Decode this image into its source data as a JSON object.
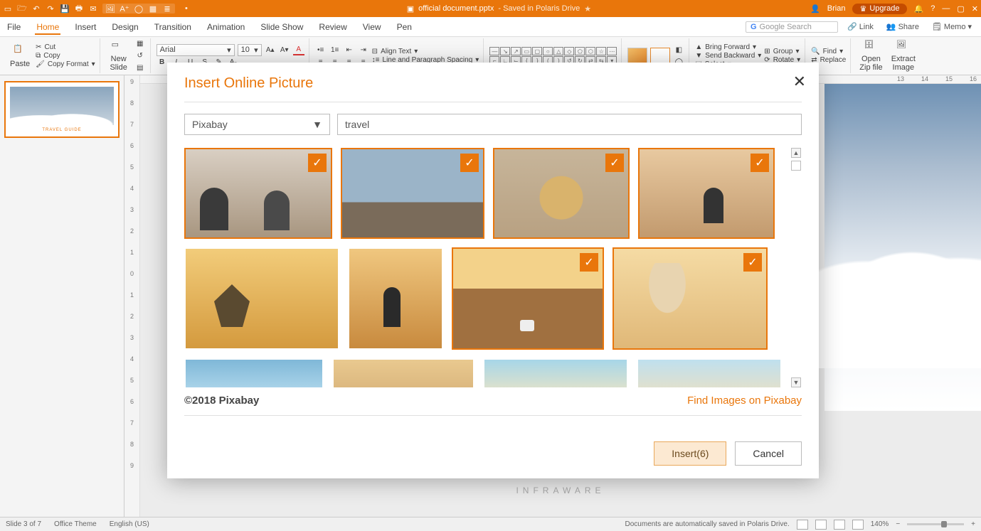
{
  "titlebar": {
    "doc_icon": "presentation-icon",
    "filename": "official document.pptx",
    "save_location": "- Saved in Polaris Drive",
    "star": "★",
    "dirty_marker": "•",
    "user_name": "Brian",
    "upgrade_label": "Upgrade"
  },
  "menu": {
    "tabs": [
      "File",
      "Home",
      "Insert",
      "Design",
      "Transition",
      "Animation",
      "Slide Show",
      "Review",
      "View",
      "Pen"
    ],
    "active_index": 1,
    "search_placeholder": "Google Search",
    "link": "Link",
    "share": "Share",
    "memo": "Memo"
  },
  "ribbon": {
    "paste": "Paste",
    "cut": "Cut",
    "copy": "Copy",
    "copy_format": "Copy Format",
    "new_slide": "New\nSlide",
    "font_name": "Arial",
    "font_size": "10",
    "bold": "B",
    "italic": "I",
    "underline": "U",
    "align_text": "Align Text",
    "line_spacing": "Line and Paragraph Spacing",
    "bring_forward": "Bring Forward",
    "send_backward": "Send Backward",
    "selectr": "Select",
    "group": "Group",
    "rotate": "Rotate",
    "find": "Find",
    "replace": "Replace",
    "open_zip": "Open\nZip file",
    "extract_image": "Extract\nImage"
  },
  "ruler_h": [
    "13",
    "14",
    "15",
    "16"
  ],
  "ruler_v": [
    "9",
    "8",
    "7",
    "6",
    "5",
    "4",
    "3",
    "2",
    "1",
    "0",
    "1",
    "2",
    "3",
    "4",
    "5",
    "6",
    "7",
    "8",
    "9"
  ],
  "thumb_caption": "TRAVEL GUIDE",
  "brand": "INFRAWARE",
  "dialog": {
    "title": "Insert Online Picture",
    "source": "Pixabay",
    "query": "travel",
    "copyright": "©2018 Pixabay",
    "find_link": "Find Images on Pixabay",
    "insert_btn": "Insert(6)",
    "cancel_btn": "Cancel"
  },
  "status": {
    "slide_pos": "Slide 3 of 7",
    "theme": "Office Theme",
    "lang": "English (US)",
    "autosave_msg": "Documents are automatically saved in Polaris Drive.",
    "zoom": "140%"
  }
}
